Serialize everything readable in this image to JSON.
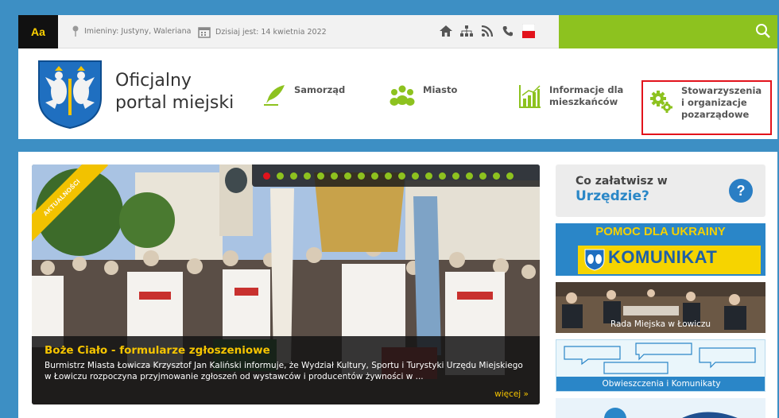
{
  "topbar": {
    "font_toggle": "Aa",
    "nameday": "Imieniny: Justyny, Waleriana",
    "today": "Dzisiaj jest: 14 kwietnia 2022",
    "icons": [
      "home-icon",
      "sitemap-icon",
      "rss-icon",
      "phone-icon",
      "bip-icon"
    ],
    "search_icon": "search-icon"
  },
  "header": {
    "title_line1": "Oficjalny",
    "title_line2": "portal miejski",
    "nav": [
      {
        "label": "Samorząd",
        "icon": "quill-icon"
      },
      {
        "label": "Miasto",
        "icon": "people-icon"
      },
      {
        "label_line1": "Informacje dla",
        "label_line2": "mieszkańców",
        "icon": "chart-icon"
      },
      {
        "label_line1": "Stowarzyszenia",
        "label_line2": "i organizacje",
        "label_line3": "pozarządowe",
        "icon": "gears-icon"
      }
    ]
  },
  "slider": {
    "ribbon": "AKTUALNOŚCI",
    "dots_total": 19,
    "active_dot": 1,
    "title": "Boże Ciało - formularze zgłoszeniowe",
    "text": "Burmistrz Miasta Łowicza Krzysztof Jan Kaliński informuje, że Wydział Kultury, Sportu i Turystyki Urzędu Miejskiego w Łowiczu rozpoczyna przyjmowanie zgłoszeń od wystawców i producentów żywności w ...",
    "more": "więcej »"
  },
  "sidebar": {
    "co_line1": "Co załatwisz w",
    "co_line2": "Urzędzie?",
    "qmark": "?",
    "ukraine_top": "POMOC DLA UKRAINY",
    "ukraine_bottom": "KOMUNIKAT",
    "rada": "Rada Miejska w Łowiczu",
    "obwieszczenia": "Obwieszczenia i Komunikaty"
  },
  "colors": {
    "accent_green": "#8dc21f",
    "accent_blue": "#2a86c8",
    "accent_yellow": "#f5c400",
    "highlight_red": "#e2131c"
  }
}
